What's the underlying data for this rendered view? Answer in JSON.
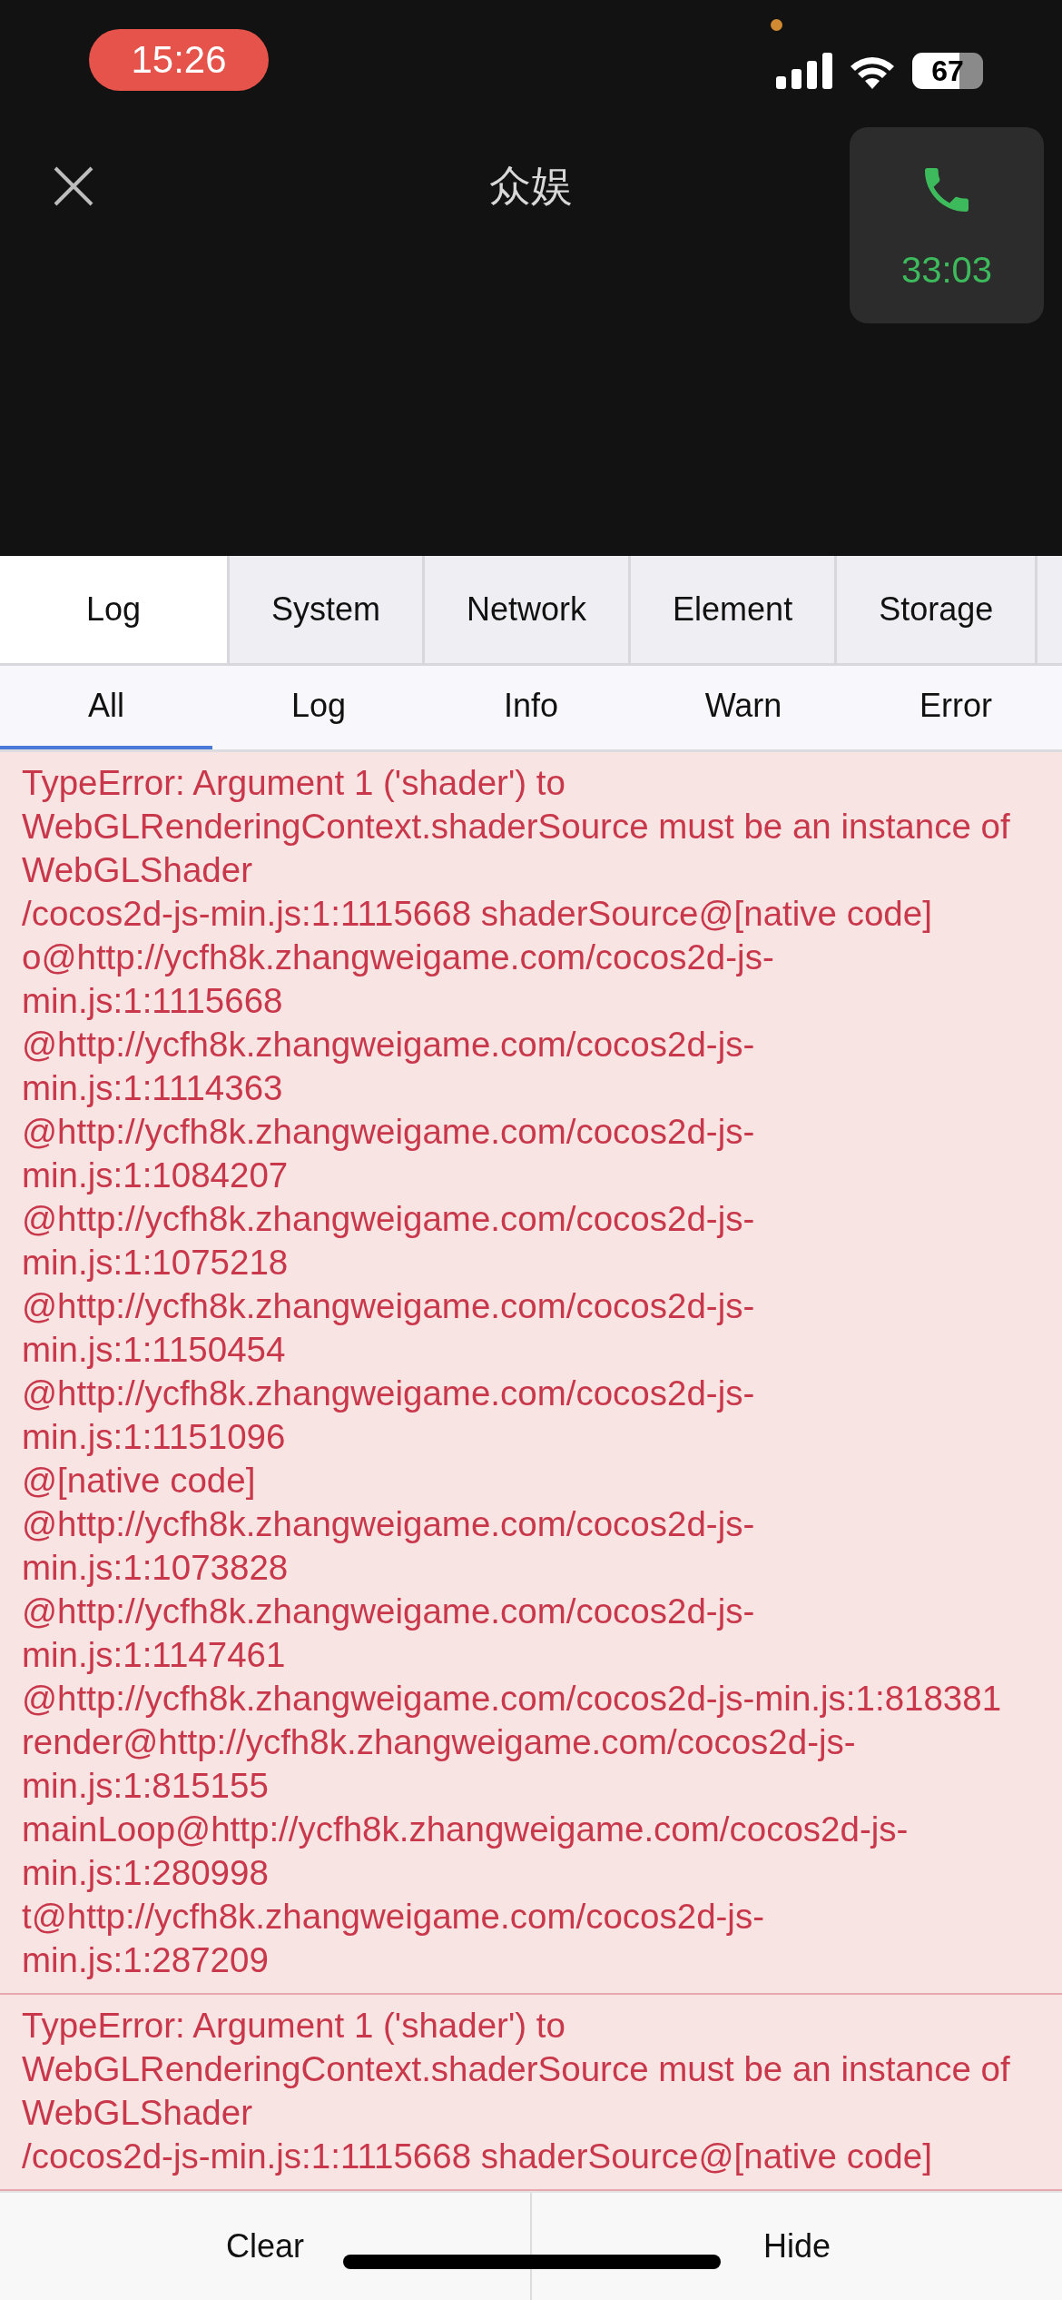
{
  "status_bar": {
    "time": "15:26",
    "battery": "67"
  },
  "header": {
    "title": "众娱",
    "call_timer": "33:03"
  },
  "tabs": [
    {
      "label": "Log",
      "selected": true
    },
    {
      "label": "System",
      "selected": false
    },
    {
      "label": "Network",
      "selected": false
    },
    {
      "label": "Element",
      "selected": false
    },
    {
      "label": "Storage",
      "selected": false
    }
  ],
  "filters": [
    {
      "label": "All",
      "selected": true
    },
    {
      "label": "Log",
      "selected": false
    },
    {
      "label": "Info",
      "selected": false
    },
    {
      "label": "Warn",
      "selected": false
    },
    {
      "label": "Error",
      "selected": false
    }
  ],
  "log_entries": [
    {
      "kind": "error",
      "text": "TypeError: Argument 1 ('shader') to\nWebGLRenderingContext.shaderSource must be an instance of\nWebGLShader\n/cocos2d-js-min.js:1:1115668 shaderSource@[native code]\no@http://ycfh8k.zhangweigame.com/cocos2d-js-\nmin.js:1:1115668\n@http://ycfh8k.zhangweigame.com/cocos2d-js-\nmin.js:1:1114363\n@http://ycfh8k.zhangweigame.com/cocos2d-js-\nmin.js:1:1084207\n@http://ycfh8k.zhangweigame.com/cocos2d-js-\nmin.js:1:1075218\n@http://ycfh8k.zhangweigame.com/cocos2d-js-\nmin.js:1:1150454\n@http://ycfh8k.zhangweigame.com/cocos2d-js-\nmin.js:1:1151096\n@[native code]\n@http://ycfh8k.zhangweigame.com/cocos2d-js-\nmin.js:1:1073828\n@http://ycfh8k.zhangweigame.com/cocos2d-js-\nmin.js:1:1147461\n@http://ycfh8k.zhangweigame.com/cocos2d-js-min.js:1:818381\nrender@http://ycfh8k.zhangweigame.com/cocos2d-js-\nmin.js:1:815155\nmainLoop@http://ycfh8k.zhangweigame.com/cocos2d-js-\nmin.js:1:280998\nt@http://ycfh8k.zhangweigame.com/cocos2d-js-\nmin.js:1:287209"
    },
    {
      "kind": "error",
      "text": "TypeError: Argument 1 ('shader') to\nWebGLRenderingContext.shaderSource must be an instance of\nWebGLShader\n/cocos2d-js-min.js:1:1115668 shaderSource@[native code]"
    }
  ],
  "toolbar": {
    "buttons": [
      "Clear",
      "Hide"
    ]
  }
}
